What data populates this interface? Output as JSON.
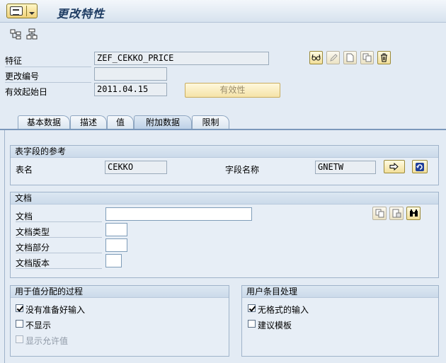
{
  "window": {
    "title": "更改特性"
  },
  "toolbar": {
    "icons": [
      "hierarchy-icon",
      "tree-icon"
    ]
  },
  "header": {
    "characteristic_label": "特征",
    "characteristic_value": "ZEF_CEKKO_PRICE",
    "change_number_label": "更改编号",
    "change_number_value": "",
    "valid_from_label": "有效起始日",
    "valid_from_value": "2011.04.15",
    "validity_button": "有效性",
    "action_icons": [
      "glasses-icon",
      "pencil-icon",
      "new-document-icon",
      "copy-icon",
      "delete-icon"
    ]
  },
  "tabs": [
    {
      "label": "基本数据",
      "active": false
    },
    {
      "label": "描述",
      "active": false
    },
    {
      "label": "值",
      "active": false
    },
    {
      "label": "附加数据",
      "active": true
    },
    {
      "label": "限制",
      "active": false
    }
  ],
  "table_ref": {
    "title": "表字段的参考",
    "table_label": "表名",
    "table_value": "CEKKO",
    "field_label": "字段名称",
    "field_value": "GNETW"
  },
  "document": {
    "title": "文档",
    "doc_label": "文档",
    "doc_value": "",
    "type_label": "文档类型",
    "type_value": "",
    "part_label": "文档部分",
    "part_value": "",
    "version_label": "文档版本",
    "version_value": ""
  },
  "value_assign": {
    "title": "用于值分配的过程",
    "options": [
      {
        "label": "没有准备好输入",
        "checked": true,
        "disabled": false
      },
      {
        "label": "不显示",
        "checked": false,
        "disabled": false
      },
      {
        "label": "显示允许值",
        "checked": false,
        "disabled": true
      }
    ]
  },
  "entry_proc": {
    "title": "用户条目处理",
    "options": [
      {
        "label": "无格式的输入",
        "checked": true
      },
      {
        "label": "建议模板",
        "checked": false
      }
    ]
  }
}
